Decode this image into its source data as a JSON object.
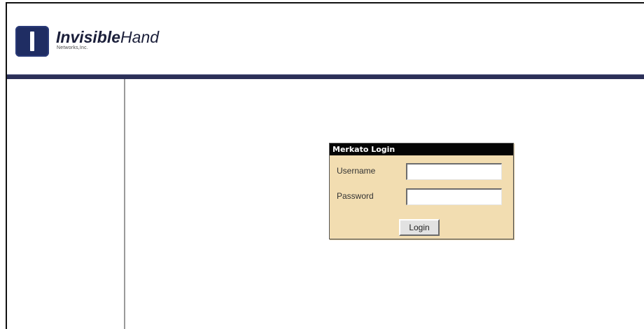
{
  "branding": {
    "name_bold": "Invisible",
    "name_light": "Hand",
    "subtitle": "Networks,Inc."
  },
  "login": {
    "title": "Merkato Login",
    "username_label": "Username",
    "username_value": "",
    "password_label": "Password",
    "password_value": "",
    "button_label": "Login"
  },
  "colors": {
    "header_rule": "#2b2f57",
    "logo_mark": "#1f2d63",
    "login_panel": "#f2ddb1",
    "login_title_bar": "#050505"
  }
}
